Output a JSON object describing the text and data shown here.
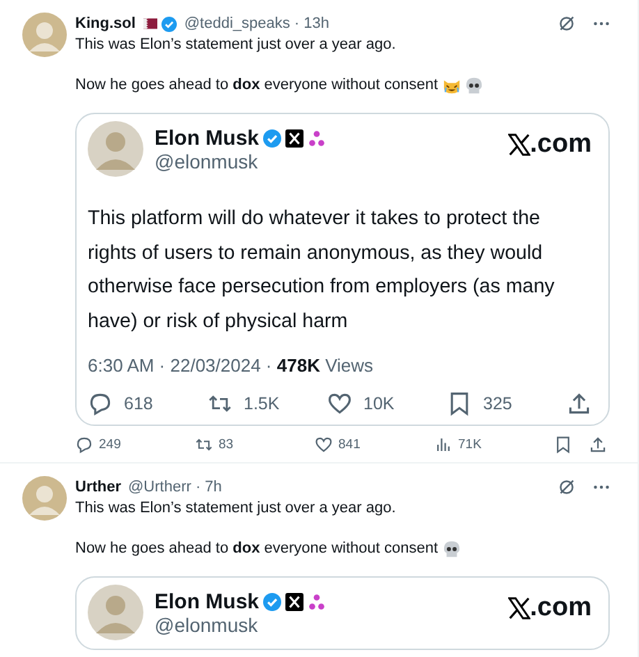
{
  "tweets": [
    {
      "author": "King.sol",
      "flag": true,
      "verified": true,
      "handle_time": "@teddi_speaks · 13h",
      "paragraphs": [
        "This was Elon’s statement just over a year ago.",
        "Now he goes ahead to **dox** everyone without consent"
      ],
      "emojis": [
        {
          "kind": "laughing-cat"
        },
        {
          "kind": "skull"
        }
      ],
      "quote": {
        "author": "Elon Musk",
        "badges": [
          {
            "kind": "verified"
          },
          {
            "kind": "x"
          },
          {
            "kind": "affiliate"
          }
        ],
        "handle": "@elonmusk",
        "site": ".com",
        "text": "This platform will do whatever it takes to protect the rights of users to remain anonymous, as they would otherwise face persecution from employers (as many have) or risk of physical harm",
        "meta": "6:30 AM · 22/03/2024 · **478K** Views",
        "stats": [
          {
            "kind": "reply",
            "count": "618"
          },
          {
            "kind": "retweet",
            "count": "1.5K"
          },
          {
            "kind": "like",
            "count": "10K"
          },
          {
            "kind": "bookmark",
            "count": "325"
          },
          {
            "kind": "share"
          }
        ]
      },
      "actions": [
        {
          "kind": "reply",
          "count": "249"
        },
        {
          "kind": "retweet",
          "count": "83"
        },
        {
          "kind": "like",
          "count": "841"
        },
        {
          "kind": "views",
          "count": "71K"
        },
        {
          "kind": "bookmark"
        },
        {
          "kind": "share"
        }
      ]
    },
    {
      "author": "Urther",
      "flag": false,
      "verified": false,
      "handle_time": "@Urtherr · 7h",
      "paragraphs": [
        "This was Elon’s statement just over a year ago.",
        "Now he goes ahead to **dox** everyone without consent"
      ],
      "emojis": [
        {
          "kind": "skull"
        }
      ],
      "quote": {
        "author": "Elon Musk",
        "badges": [
          {
            "kind": "verified"
          },
          {
            "kind": "x"
          },
          {
            "kind": "affiliate"
          }
        ],
        "handle": "@elonmusk",
        "site": ".com"
      }
    }
  ]
}
